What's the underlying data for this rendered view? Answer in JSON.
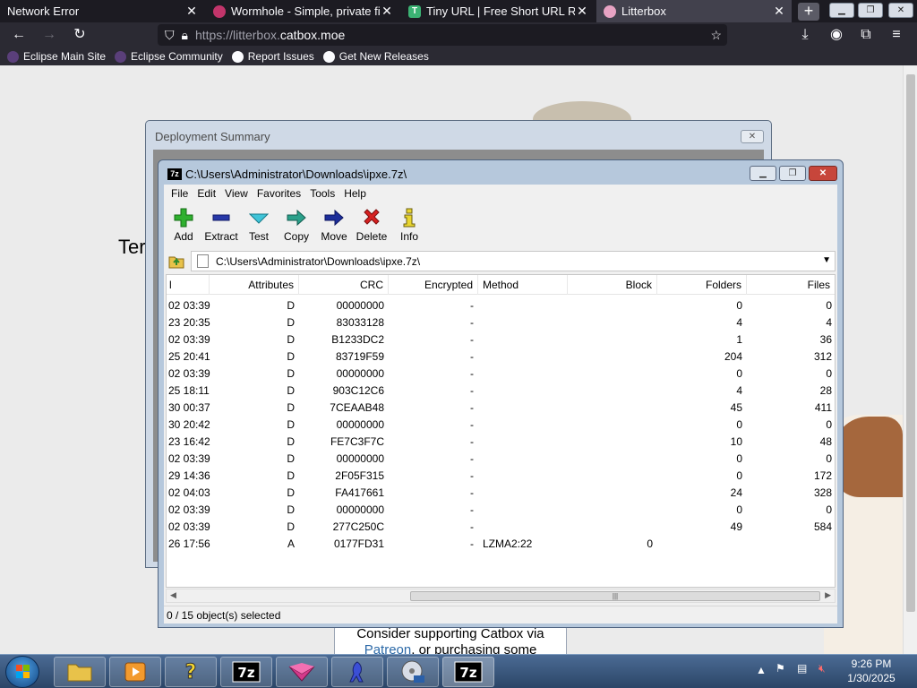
{
  "browser": {
    "tabs": [
      {
        "label": "Network Error",
        "close": "✕"
      },
      {
        "label": "Wormhole - Simple, private file",
        "close": "✕"
      },
      {
        "label": "Tiny URL | Free Short URL Redi",
        "close": "✕"
      },
      {
        "label": "Litterbox",
        "close": "✕"
      }
    ],
    "url_dim": "https://litterbox.",
    "url_main": "catbox.moe",
    "bookmarks": [
      "Eclipse Main Site",
      "Eclipse Community",
      "Report Issues",
      "Get New Releases"
    ]
  },
  "webpage": {
    "heading_fragment": "Ter",
    "footer_line1": "Consider supporting Catbox via",
    "footer_link": "Patreon",
    "footer_line2_rest": ", or purchasing some"
  },
  "deploy_window": {
    "title": "Deployment Summary"
  },
  "zip": {
    "title": "C:\\Users\\Administrator\\Downloads\\ipxe.7z\\",
    "menu": [
      "File",
      "Edit",
      "View",
      "Favorites",
      "Tools",
      "Help"
    ],
    "toolbar": [
      "Add",
      "Extract",
      "Test",
      "Copy",
      "Move",
      "Delete",
      "Info"
    ],
    "path": "C:\\Users\\Administrator\\Downloads\\ipxe.7z\\",
    "columns": [
      "l",
      "Attributes",
      "CRC",
      "Encrypted",
      "Method",
      "Block",
      "Folders",
      "Files"
    ],
    "rows": [
      {
        "modified": "02 03:39",
        "attr": "D",
        "crc": "00000000",
        "enc": "-",
        "method": "",
        "block": "",
        "folders": "0",
        "files": "0"
      },
      {
        "modified": "23 20:35",
        "attr": "D",
        "crc": "83033128",
        "enc": "-",
        "method": "",
        "block": "",
        "folders": "4",
        "files": "4"
      },
      {
        "modified": "02 03:39",
        "attr": "D",
        "crc": "B1233DC2",
        "enc": "-",
        "method": "",
        "block": "",
        "folders": "1",
        "files": "36"
      },
      {
        "modified": "25 20:41",
        "attr": "D",
        "crc": "83719F59",
        "enc": "-",
        "method": "",
        "block": "",
        "folders": "204",
        "files": "312"
      },
      {
        "modified": "02 03:39",
        "attr": "D",
        "crc": "00000000",
        "enc": "-",
        "method": "",
        "block": "",
        "folders": "0",
        "files": "0"
      },
      {
        "modified": "25 18:11",
        "attr": "D",
        "crc": "903C12C6",
        "enc": "-",
        "method": "",
        "block": "",
        "folders": "4",
        "files": "28"
      },
      {
        "modified": "30 00:37",
        "attr": "D",
        "crc": "7CEAAB48",
        "enc": "-",
        "method": "",
        "block": "",
        "folders": "45",
        "files": "411"
      },
      {
        "modified": "30 20:42",
        "attr": "D",
        "crc": "00000000",
        "enc": "-",
        "method": "",
        "block": "",
        "folders": "0",
        "files": "0"
      },
      {
        "modified": "23 16:42",
        "attr": "D",
        "crc": "FE7C3F7C",
        "enc": "-",
        "method": "",
        "block": "",
        "folders": "10",
        "files": "48"
      },
      {
        "modified": "02 03:39",
        "attr": "D",
        "crc": "00000000",
        "enc": "-",
        "method": "",
        "block": "",
        "folders": "0",
        "files": "0"
      },
      {
        "modified": "29 14:36",
        "attr": "D",
        "crc": "2F05F315",
        "enc": "-",
        "method": "",
        "block": "",
        "folders": "0",
        "files": "172"
      },
      {
        "modified": "02 04:03",
        "attr": "D",
        "crc": "FA417661",
        "enc": "-",
        "method": "",
        "block": "",
        "folders": "24",
        "files": "328"
      },
      {
        "modified": "02 03:39",
        "attr": "D",
        "crc": "00000000",
        "enc": "-",
        "method": "",
        "block": "",
        "folders": "0",
        "files": "0"
      },
      {
        "modified": "02 03:39",
        "attr": "D",
        "crc": "277C250C",
        "enc": "-",
        "method": "",
        "block": "",
        "folders": "49",
        "files": "584"
      },
      {
        "modified": "26 17:56",
        "attr": "A",
        "crc": "0177FD31",
        "enc": "-",
        "method": "LZMA2:22",
        "block": "0",
        "folders": "",
        "files": ""
      }
    ],
    "status": "0 / 15 object(s) selected"
  },
  "taskbar": {
    "time": "9:26 PM",
    "date": "1/30/2025",
    "apps": [
      "explorer",
      "media-player",
      "help",
      "7-zip",
      "app-pink",
      "app-blue",
      "dvd-tool",
      "7-zip-active"
    ]
  }
}
